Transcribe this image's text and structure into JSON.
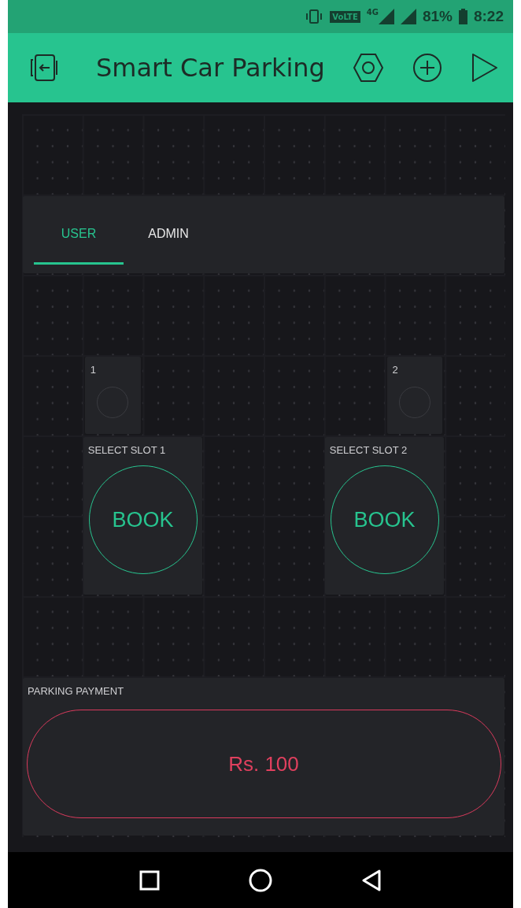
{
  "status_bar": {
    "volte": "VoLTE",
    "network": "4G",
    "battery": "81%",
    "time": "8:22"
  },
  "app_bar": {
    "title": "Smart Car Parking"
  },
  "tabs": [
    {
      "label": "USER",
      "selected": true
    },
    {
      "label": "ADMIN",
      "selected": false
    }
  ],
  "leds": [
    {
      "label": "1",
      "on": false
    },
    {
      "label": "2",
      "on": false
    }
  ],
  "buttons": [
    {
      "label": "SELECT SLOT 1",
      "text": "BOOK"
    },
    {
      "label": "SELECT SLOT 2",
      "text": "BOOK"
    }
  ],
  "payment": {
    "label": "PARKING PAYMENT",
    "text": "Rs. 100"
  }
}
